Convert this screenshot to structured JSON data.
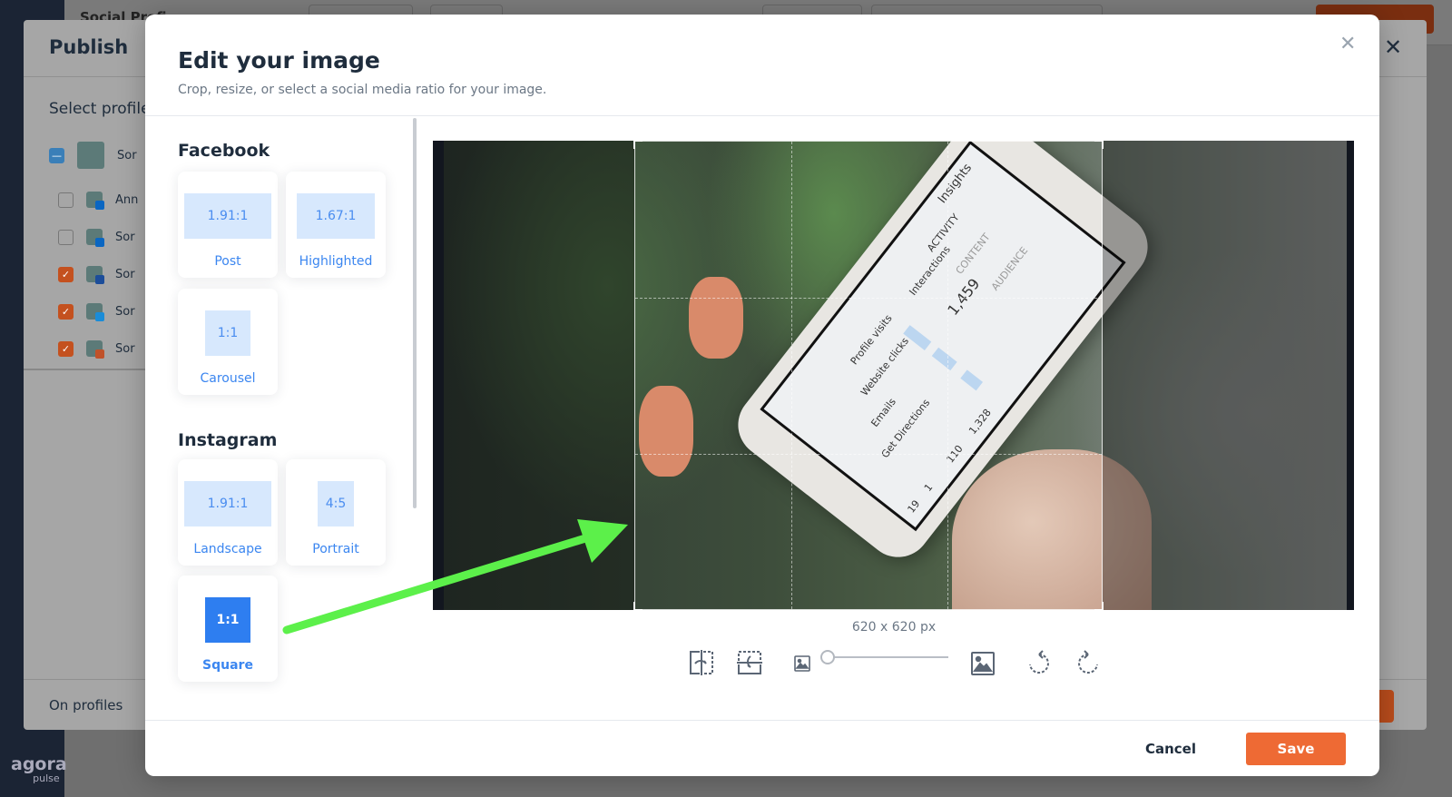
{
  "background": {
    "app_title": "Social Profi",
    "brand": {
      "name": "agora",
      "sub": "pulse"
    },
    "publish": {
      "title": "Publish",
      "select_label": "Select profile",
      "profiles": [
        {
          "name": "Sor",
          "state": "partial",
          "network": "group"
        },
        {
          "name": "Ann",
          "state": "unchecked",
          "network": "linkedin"
        },
        {
          "name": "Sor",
          "state": "unchecked",
          "network": "linkedin"
        },
        {
          "name": "Sor",
          "state": "checked",
          "network": "facebook"
        },
        {
          "name": "Sor",
          "state": "checked",
          "network": "twitter"
        },
        {
          "name": "Sor",
          "state": "checked",
          "network": "instagram"
        }
      ],
      "on_profiles_label": "On profiles"
    }
  },
  "modal": {
    "title": "Edit your image",
    "subtitle": "Crop, resize, or select a social media ratio for your image.",
    "sections": [
      {
        "title": "Facebook",
        "options": [
          {
            "ratio": "1.91:1",
            "label": "Post"
          },
          {
            "ratio": "1.67:1",
            "label": "Highlighted"
          },
          {
            "ratio": "1:1",
            "label": "Carousel"
          }
        ]
      },
      {
        "title": "Instagram",
        "options": [
          {
            "ratio": "1.91:1",
            "label": "Landscape"
          },
          {
            "ratio": "4:5",
            "label": "Portrait"
          },
          {
            "ratio": "1:1",
            "label": "Square",
            "selected": true
          }
        ]
      }
    ],
    "image_size": "620 x 620 px",
    "zoom_level": 0,
    "photo_text": {
      "header": "Insights",
      "tab1": "ACTIVITY",
      "tab2": "CONTENT",
      "tab3": "AUDIENCE",
      "section": "Interactions",
      "total": "1,459",
      "row1": "Profile visits",
      "row2": "Website clicks",
      "row3": "Emails",
      "row4": "Get Directions",
      "v1": "1,328",
      "v2": "110",
      "v3": "1",
      "v4": "19"
    },
    "cancel_label": "Cancel",
    "save_label": "Save"
  },
  "colors": {
    "accent": "#3b86f0",
    "selected": "#2e7ef0",
    "save": "#ee6a34",
    "annotation_arrow": "#5cf04a"
  }
}
